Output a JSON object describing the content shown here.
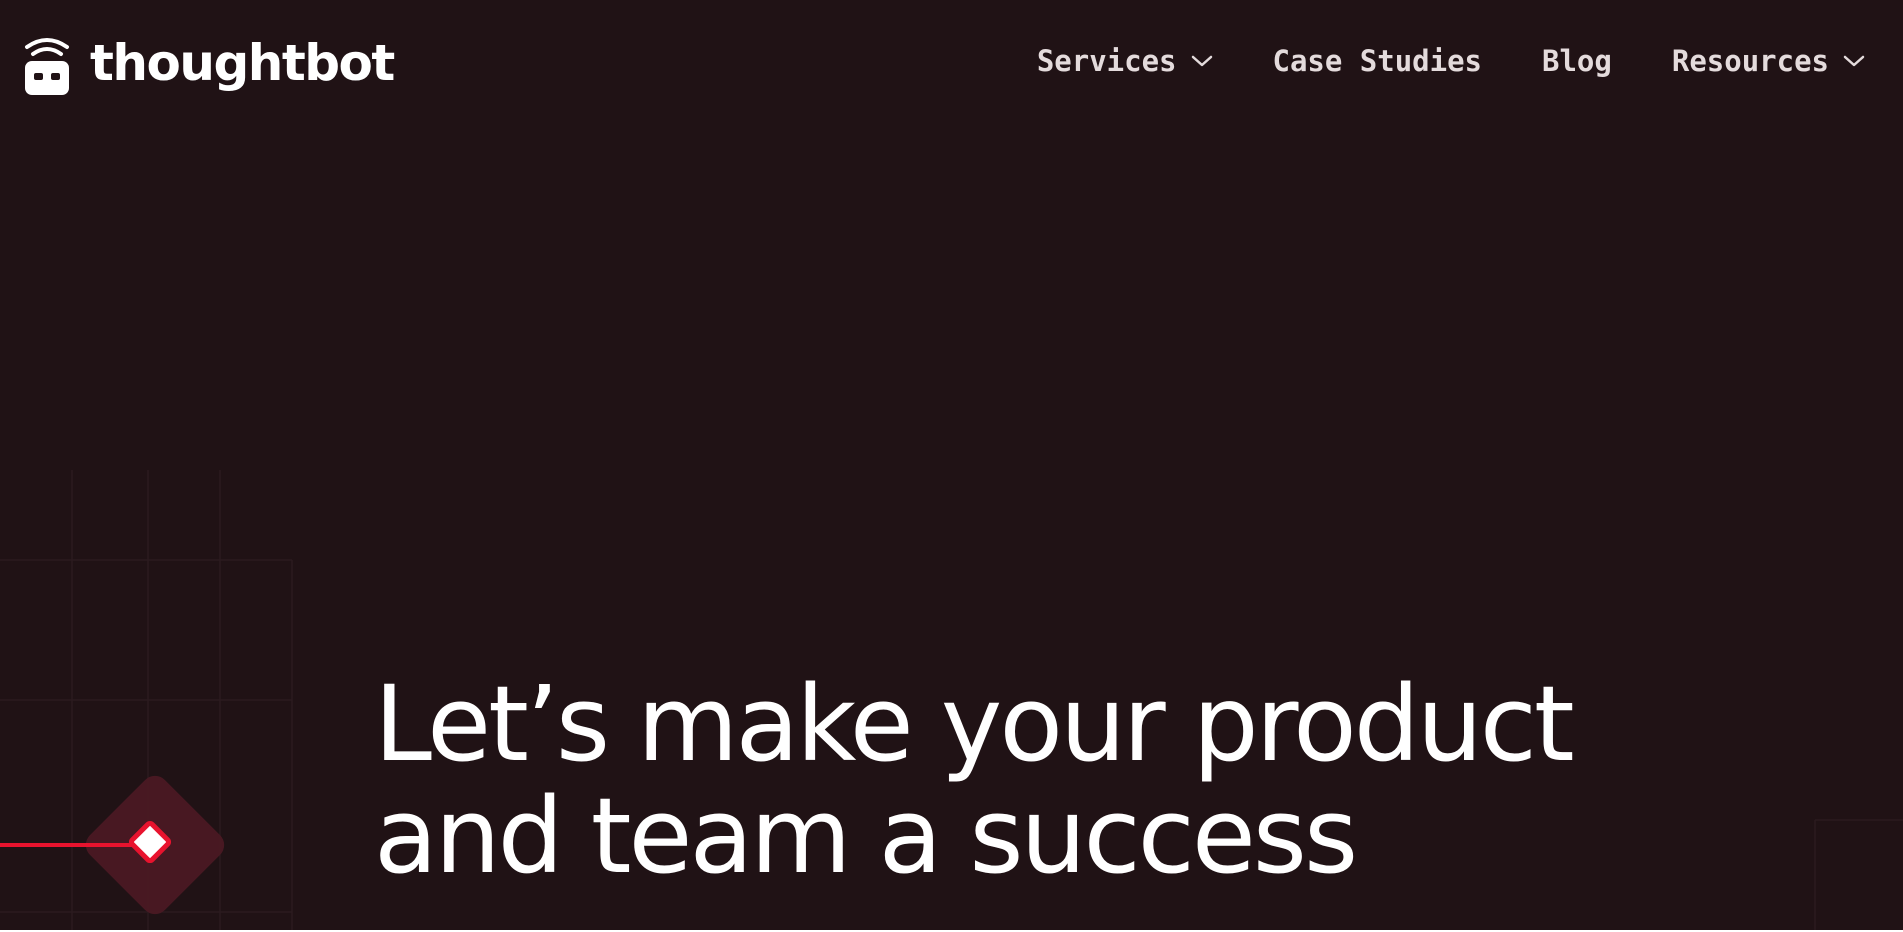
{
  "brand": {
    "name": "thoughtbot",
    "logo_icon": "robot-wifi-icon"
  },
  "nav": {
    "items": [
      {
        "label": "Services",
        "has_dropdown": true
      },
      {
        "label": "Case Studies",
        "has_dropdown": false
      },
      {
        "label": "Blog",
        "has_dropdown": false
      },
      {
        "label": "Resources",
        "has_dropdown": true
      }
    ]
  },
  "hero": {
    "headline_line1": "Let’s make your product",
    "headline_line2": "and team a success"
  },
  "colors": {
    "background": "#201215",
    "text": "#ffffff",
    "nav_text": "#e4dbdc",
    "accent": "#e8132e"
  }
}
